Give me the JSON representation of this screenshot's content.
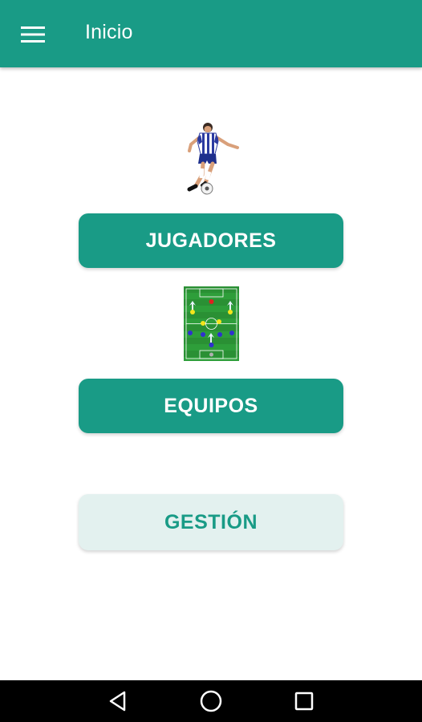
{
  "appbar": {
    "title": "Inicio",
    "menu_icon": "hamburger-menu-icon",
    "background": "#199B86"
  },
  "main": {
    "players_illustration": "soccer-player-kicking-ball",
    "players_button_label": "JUGADORES",
    "teams_illustration": "soccer-field-formation",
    "teams_button_label": "EQUIPOS",
    "management_button_label": "GESTIÓN"
  },
  "colors": {
    "accent": "#199B86",
    "light_button": "#E3F1EF"
  },
  "navbar": {
    "back_icon": "back-triangle-icon",
    "home_icon": "home-circle-icon",
    "recents_icon": "recents-square-icon"
  }
}
